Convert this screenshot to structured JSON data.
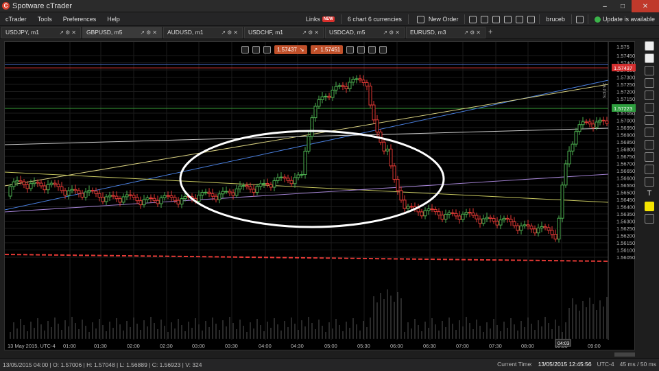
{
  "window": {
    "title": "Spotware cTrader",
    "app_icon": "C"
  },
  "menu": {
    "items": [
      "cTrader",
      "Tools",
      "Preferences",
      "Help"
    ],
    "links_label": "Links",
    "links_badge": "NEW",
    "chart_info": "6 chart 6 currencies",
    "new_order": "New Order",
    "user": "bruceb",
    "update_label": "Update is available"
  },
  "tabs": [
    {
      "label": "USDJPY, m1",
      "active": false
    },
    {
      "label": "GBPUSD, m5",
      "active": true
    },
    {
      "label": "AUDUSD, m1",
      "active": false
    },
    {
      "label": "USDCHF, m1",
      "active": false
    },
    {
      "label": "USDCAD, m5",
      "active": false
    },
    {
      "label": "EURUSD, m3",
      "active": false
    }
  ],
  "toolbar": {
    "bid": "1.57437",
    "ask": "1.57451"
  },
  "chart_data": {
    "type": "candlestick",
    "symbol": "GBPUSD",
    "timeframe": "m5",
    "y_ticks": [
      "1.57450",
      "1.57400",
      "1.57350",
      "1.57300",
      "1.57250",
      "1.57200",
      "1.57150",
      "1.57100",
      "1.57050",
      "1.57000",
      "1.56950",
      "1.56900",
      "1.56850",
      "1.56800",
      "1.56750",
      "1.56700",
      "1.56650",
      "1.56600",
      "1.56550",
      "1.56500",
      "1.56450",
      "1.56400",
      "1.56350",
      "1.56300",
      "1.56250",
      "1.56200",
      "1.56150",
      "1.56100",
      "1.56050"
    ],
    "top_tick": "1.575",
    "extra_tick": "1.57500",
    "x_ticks": [
      "13 May 2015, UTC-4",
      "01:00",
      "01:30",
      "02:00",
      "02:30",
      "03:00",
      "03:30",
      "04:00",
      "04:30",
      "05:00",
      "05:30",
      "06:00",
      "06:30",
      "07:00",
      "07:30",
      "08:00",
      "08:30",
      "09:00"
    ],
    "current_price_label": "1.57437",
    "green_line_label": "1.57223",
    "crosshair_time": "04:03",
    "pips_label": "25 PIPS",
    "bullish_color": "#4caf50",
    "bearish_color": "#e53935"
  },
  "status": {
    "ohlc": "13/05/2015 04:00 | O: 1.57006 | H: 1.57048 | L: 1.56889 | C: 1.56923 | V: 324",
    "current_time_label": "Current Time:",
    "current_time": "13/05/2015 12:45:56",
    "tz": "UTC-4",
    "latency": "45 ms / 50 ms"
  },
  "colors": {
    "accent": "#d8412f",
    "green": "#3bb34a"
  }
}
